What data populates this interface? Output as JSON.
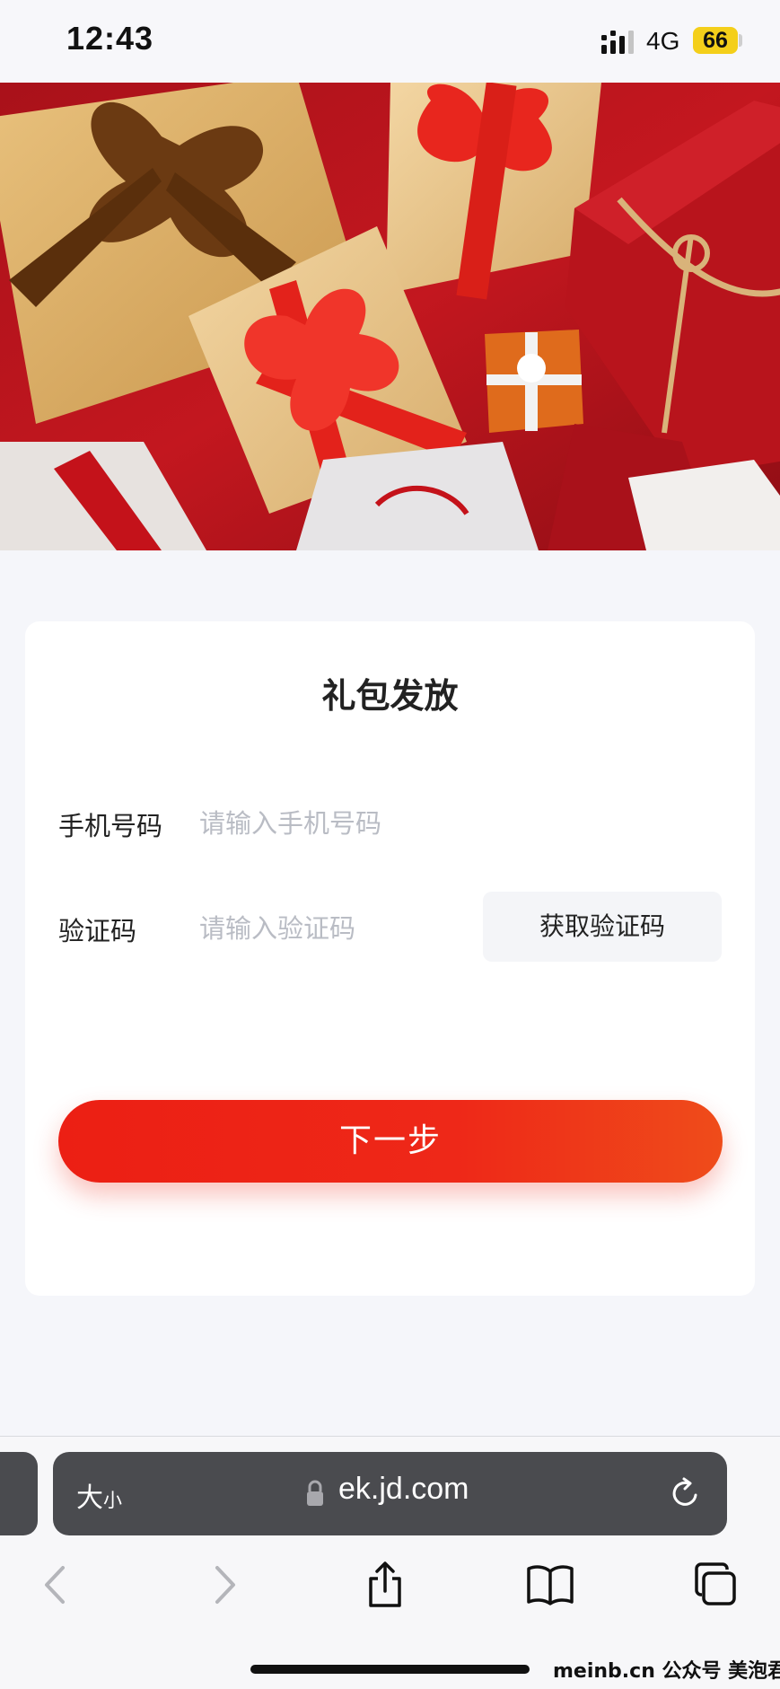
{
  "status_bar": {
    "time": "12:43",
    "network": "4G",
    "battery": "66",
    "battery_color": "#f4cf1a"
  },
  "hero": {
    "image": "gift-boxes-banner"
  },
  "form": {
    "title": "礼包发放",
    "phone_label": "手机号码",
    "phone_placeholder": "请输入手机号码",
    "code_label": "验证码",
    "code_placeholder": "请输入验证码",
    "get_code_label": "获取验证码",
    "next_label": "下一步",
    "accent_color": "#ec1f14"
  },
  "browser": {
    "text_size_label": "大",
    "text_size_small": "小",
    "url": "ek.jd.com",
    "icons": [
      "lock-icon",
      "reload-icon",
      "back-icon",
      "forward-icon",
      "share-icon",
      "bookmarks-icon",
      "tabs-icon"
    ]
  },
  "watermark": "meinb.cn  公众号 美泡君"
}
